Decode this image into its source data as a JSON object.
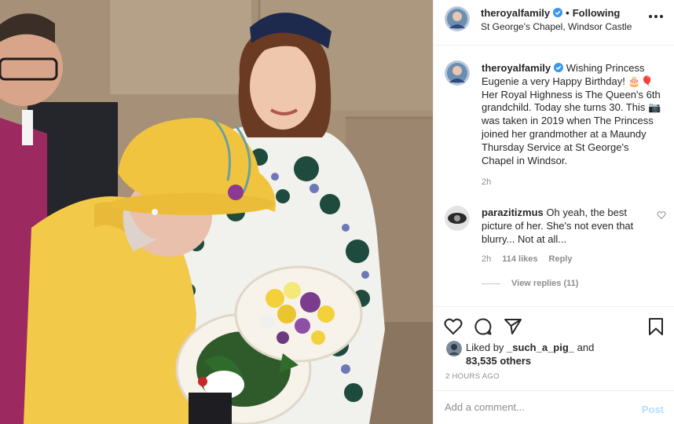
{
  "post": {
    "username": "theroyalfamily",
    "follow_status": "Following",
    "location": "St George's Chapel, Windsor Castle"
  },
  "caption": {
    "username": "theroyalfamily",
    "text": "Wishing Princess Eugenie a very Happy Birthday! 🎂🎈 Her Royal Highness is The Queen's 6th grandchild. Today she turns 30. This 📷was taken in 2019 when The Princess joined her grandmother at a Maundy Thursday Service at St George's Chapel in Windsor.",
    "time": "2h"
  },
  "comment": {
    "username": "parazitizmus",
    "text": "Oh yeah, the best picture of her. She's not even that blurry... Not at all...",
    "time": "2h",
    "likes": "114 likes",
    "reply_label": "Reply",
    "view_replies": "View replies (11)"
  },
  "likes": {
    "prefix": "Liked by",
    "user": "_such_a_pig_",
    "and": "and",
    "others": "83,535 others"
  },
  "date": "2 HOURS AGO",
  "comment_input": {
    "placeholder": "Add a comment...",
    "post_label": "Post"
  },
  "icons": {
    "verified": "verified-badge-icon",
    "more": "more-options-icon",
    "like": "heart-icon",
    "comment": "comment-bubble-icon",
    "share": "paper-plane-icon",
    "save": "bookmark-icon"
  },
  "colors": {
    "verified": "#3897f0",
    "muted": "#8e8e8e",
    "post_disabled": "#b2dffc"
  }
}
